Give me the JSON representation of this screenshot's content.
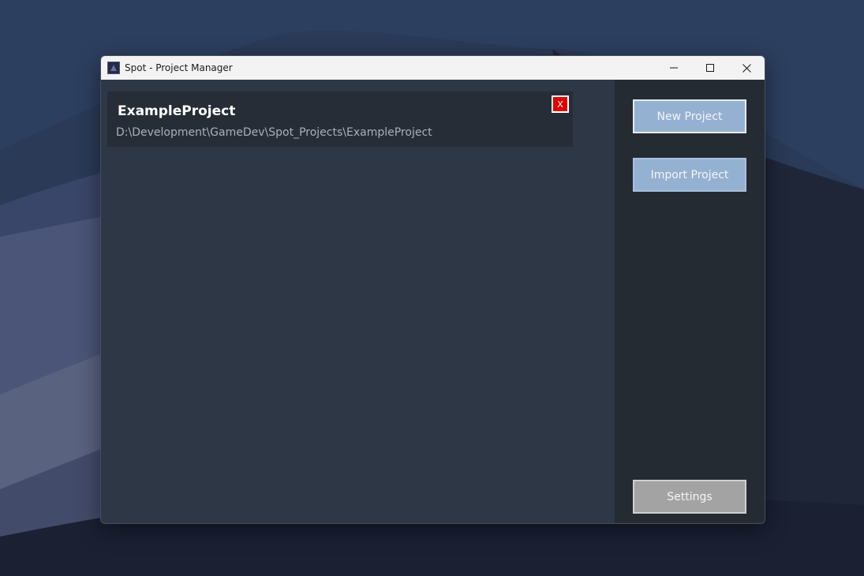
{
  "window": {
    "title": "Spot - Project Manager",
    "app_icon": "spot-app-icon",
    "controls": [
      "minimize-icon",
      "maximize-icon",
      "close-icon"
    ]
  },
  "projects": [
    {
      "name": "ExampleProject",
      "path": "D:\\Development\\GameDev\\Spot_Projects\\ExampleProject",
      "remove_label": "X"
    }
  ],
  "sidebar": {
    "new_project_label": "New Project",
    "import_project_label": "Import Project",
    "settings_label": "Settings"
  },
  "colors": {
    "panel_bg": "#2d3745",
    "sidebar_bg": "#252b33",
    "primary_button": "#95b1d1",
    "settings_button": "#a3a3a3",
    "remove_button": "#e10000"
  }
}
